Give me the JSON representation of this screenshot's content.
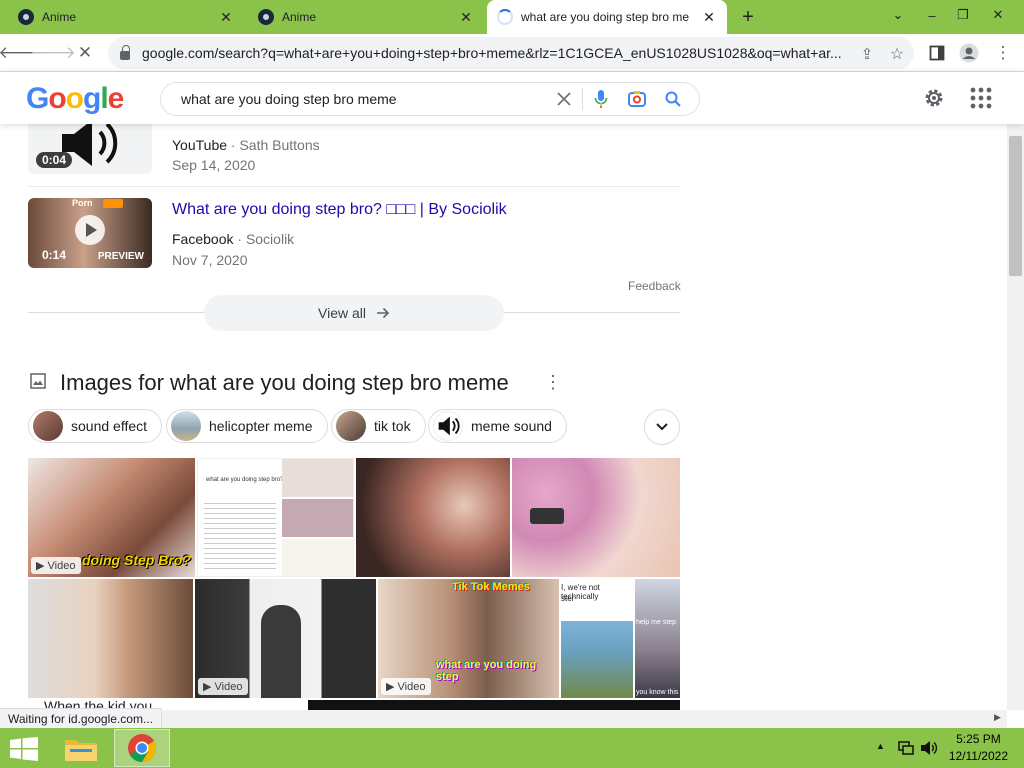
{
  "browser": {
    "tabs": [
      {
        "title": "Anime",
        "active": false
      },
      {
        "title": "Anime",
        "active": false
      },
      {
        "title": "what are you doing step bro me",
        "active": true
      }
    ],
    "new_tab_glyph": "+",
    "url": "google.com/search?q=what+are+you+doing+step+bro+meme&rlz=1C1GCEA_enUS1028US1028&oq=what+ar..."
  },
  "google": {
    "logo": [
      "G",
      "o",
      "o",
      "g",
      "l",
      "e"
    ],
    "logo_colors": [
      "#4285f4",
      "#ea4335",
      "#fbbc05",
      "#4285f4",
      "#34a853",
      "#ea4335"
    ],
    "query": "what are you doing step bro meme"
  },
  "videos": [
    {
      "duration": "0:04",
      "title": "",
      "source": "YouTube",
      "channel": "Sath Buttons",
      "date": "Sep 14, 2020"
    },
    {
      "duration": "0:14",
      "badge": "PREVIEW",
      "thumb_text": "Porn",
      "title": "What are you doing step bro? □□□ | By Sociolik",
      "source": "Facebook",
      "channel": "Sociolik",
      "date": "Nov 7, 2020"
    }
  ],
  "feedback": "Feedback",
  "view_all": "View all",
  "images_section": {
    "heading": "Images for what are you doing step bro meme",
    "chips": [
      "sound effect",
      "helicopter meme",
      "tik tok",
      "meme sound"
    ],
    "image_captions": {
      "img1": "doing Step Bro?",
      "img2": "what are you doing step bro?",
      "img6": "Tik Tok Memes",
      "img6b": "what are you doing step",
      "img7": "I, we're not technically",
      "img7b": "ster",
      "img8": "help me step",
      "img8b": "you know this",
      "img9": "When the kid you"
    },
    "video_label": "Video"
  },
  "status_text": "Waiting for id.google.com...",
  "clock": {
    "time": "5:25 PM",
    "date": "12/11/2022"
  },
  "colors": {
    "tab_strip": "#8bc34a",
    "link": "#1a0dab",
    "accent": "#1a73e8"
  }
}
